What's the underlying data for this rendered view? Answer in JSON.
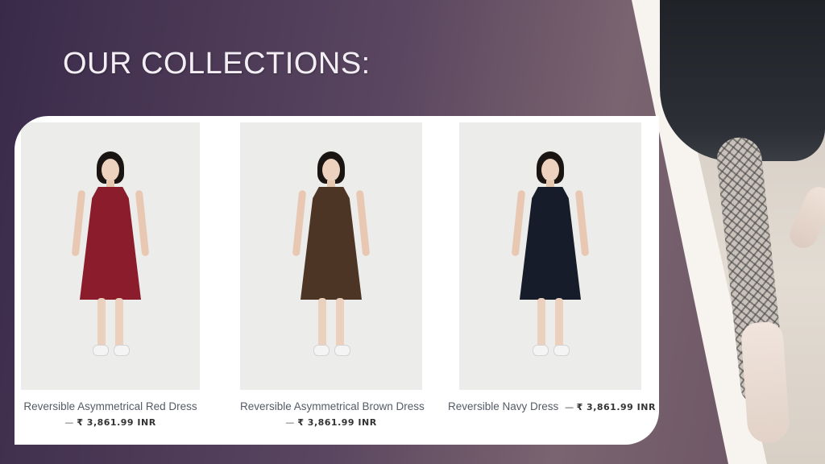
{
  "slide": {
    "title": "OUR COLLECTIONS:"
  },
  "products": [
    {
      "name": "Reversible Asymmetrical Red Dress",
      "dash": "—",
      "price": "₹ 3,861.99 INR",
      "dress_color": "#8a1c2c"
    },
    {
      "name": "Reversible Asymmetrical Brown Dress",
      "dash": "—",
      "price": "₹ 3,861.99 INR",
      "dress_color": "#4d3526"
    },
    {
      "name": "Reversible Navy Dress",
      "dash": "—",
      "price": "₹ 3,861.99 INR",
      "dress_color": "#161c2a"
    }
  ],
  "colors": {
    "background": "#4b3a56",
    "title": "#f2eef4",
    "panel": "#ffffff",
    "caption": "#555b66"
  }
}
